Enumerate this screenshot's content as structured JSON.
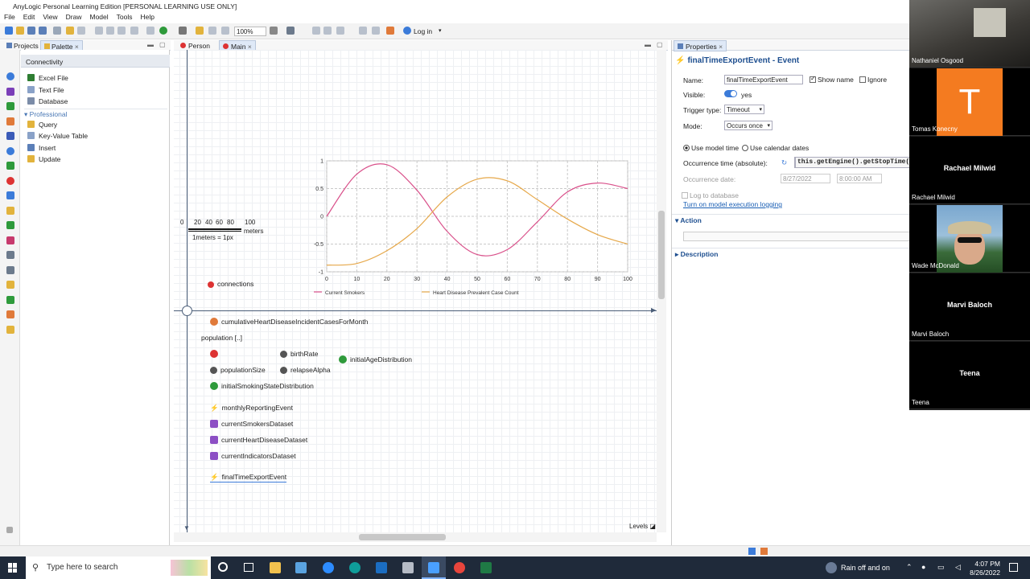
{
  "window": {
    "title": "AnyLogic Personal Learning Edition [PERSONAL LEARNING USE ONLY]"
  },
  "menu": [
    "File",
    "Edit",
    "View",
    "Draw",
    "Model",
    "Tools",
    "Help"
  ],
  "toolbar": {
    "zoom": "100%",
    "login": "Log in"
  },
  "left_panel": {
    "tabs": [
      "Projects",
      "Palette"
    ],
    "section": "Connectivity",
    "items_top": [
      "Excel File",
      "Text File",
      "Database"
    ],
    "group": "Professional",
    "items_prof": [
      "Query",
      "Key-Value Table",
      "Insert",
      "Update"
    ]
  },
  "editor": {
    "tabs": [
      "Person",
      "Main"
    ],
    "scale_ticks": [
      "0",
      "20",
      "40",
      "60",
      "80",
      "100"
    ],
    "scale_unit": "meters",
    "scale_note": "1meters = 1px",
    "connections": "connections",
    "variable": "cumulativeHeartDiseaseIncidentCasesForMonth",
    "population": "population [..]",
    "params": [
      "birthRate",
      "populationSize",
      "relapseAlpha",
      "initialSmokingStateDistribution",
      "initialAgeDistribution"
    ],
    "events": [
      "monthlyReportingEvent",
      "finalTimeExportEvent"
    ],
    "datasets": [
      "currentSmokersDataset",
      "currentHeartDiseaseDataset",
      "currentIndicatorsDataset"
    ],
    "levels": "Levels"
  },
  "chart_data": {
    "type": "line",
    "xlim": [
      0,
      100
    ],
    "ylim": [
      -1,
      1
    ],
    "x_ticks": [
      "0",
      "10",
      "20",
      "30",
      "40",
      "50",
      "60",
      "70",
      "80",
      "90",
      "100"
    ],
    "y_ticks": [
      "1",
      "0.5",
      "0",
      "-0.5",
      "-1"
    ],
    "grid": true,
    "legend_position": "bottom",
    "x": [
      0,
      10,
      20,
      30,
      40,
      50,
      60,
      70,
      80,
      90,
      100
    ],
    "series": [
      {
        "name": "Current Smokers",
        "color": "#d9508a",
        "values": [
          0.0,
          0.76,
          0.93,
          0.47,
          -0.27,
          -0.69,
          -0.6,
          -0.1,
          0.44,
          0.6,
          0.5
        ]
      },
      {
        "name": "Heart Disease Prevalent Case Count",
        "color": "#e6a84a",
        "values": [
          -0.88,
          -0.85,
          -0.62,
          -0.22,
          0.35,
          0.67,
          0.64,
          0.3,
          -0.05,
          -0.33,
          -0.5
        ]
      }
    ]
  },
  "properties": {
    "tab": "Properties",
    "heading": "finalTimeExportEvent - Event",
    "name_label": "Name:",
    "name_value": "finalTimeExportEvent",
    "show_name": "Show name",
    "ignore": "Ignore",
    "visible_label": "Visible:",
    "visible_value": "yes",
    "trigger_label": "Trigger type:",
    "trigger_value": "Timeout",
    "mode_label": "Mode:",
    "mode_value": "Occurs once",
    "radio_model": "Use model time",
    "radio_calendar": "Use calendar dates",
    "occ_time_label": "Occurrence time (absolute):",
    "occ_time_value": "this.getEngine().getStopTime(",
    "occ_date_label": "Occurrence date:",
    "occ_date_value": "8/27/2022",
    "occ_time_of_day": "8:00:00 AM",
    "log_db": "Log to database",
    "logging_link": "Turn on model execution logging",
    "action": "Action",
    "description": "Description"
  },
  "participants": [
    {
      "name": "Nathaniel Osgood",
      "type": "video"
    },
    {
      "name": "Tomas Konecny",
      "type": "initial",
      "initial": "T",
      "color": "#f47b20"
    },
    {
      "name": "Rachael Milwid",
      "type": "name"
    },
    {
      "name": "Wade McDonald",
      "type": "photo"
    },
    {
      "name": "Marvi Baloch",
      "type": "name"
    },
    {
      "name": "Teena",
      "type": "name"
    }
  ],
  "taskbar": {
    "search_placeholder": "Type here to search",
    "weather": "Rain off and on",
    "time": "4:07 PM",
    "date": "8/26/2022"
  }
}
